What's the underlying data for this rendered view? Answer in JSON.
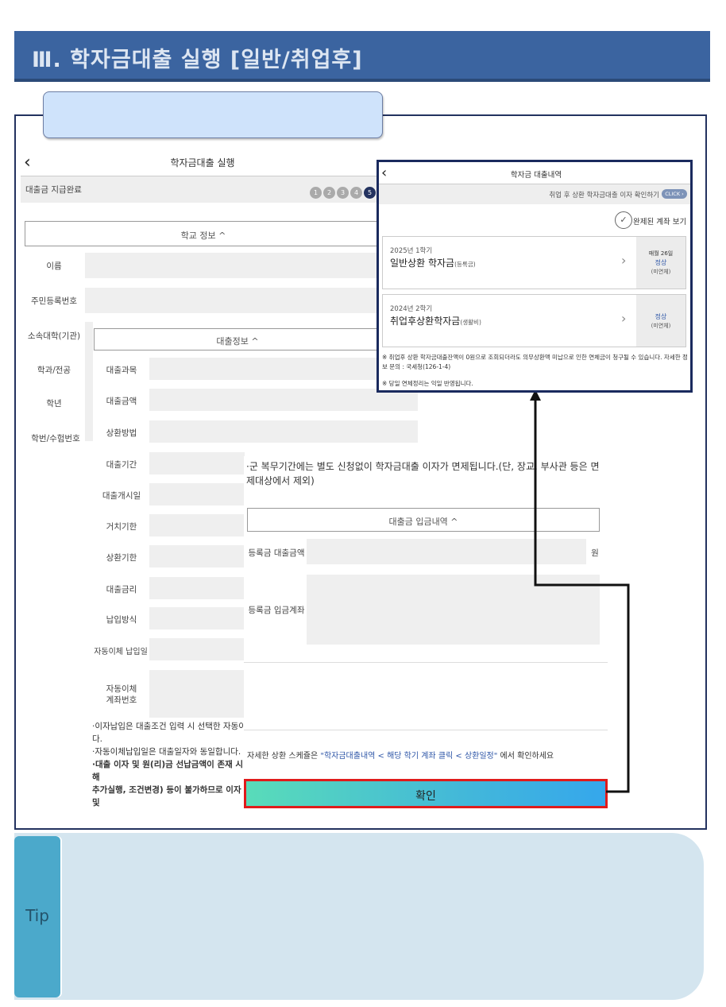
{
  "header": {
    "title": "Ⅲ. 학자금대출 실행 [일반/취업후]"
  },
  "app": {
    "title": "학자금대출 실행",
    "status": "대출금 지급완료",
    "steps": [
      "1",
      "2",
      "3",
      "4",
      "5"
    ],
    "school_section": "학교 정보 ^",
    "school_fields": [
      "이름",
      "주민등록번호",
      "소속대학(기관)",
      "학과/전공",
      "학년",
      "학번/수험번호"
    ],
    "loan_section": "대출정보 ^",
    "loan_fields": [
      "대출과목",
      "대출금액",
      "상환방법",
      "대출기간",
      "대출개시일",
      "거치기한",
      "상환기한",
      "대출금리",
      "납입방식",
      "자동이체 납입일"
    ],
    "auto_account_label": "자동이체\n계좌번호",
    "notes": {
      "line1": "·이자납입은 대출조건 입력 시 선택한 자동이",
      "line2": "다.",
      "line3": "·자동이체납입일은 대출일자와 동일합니다.",
      "line4": "·대출 이자 및 원(리)금 선납금액이 존재 시 해",
      "line5": "추가실행, 조건변경) 등이 불가하므로 이자 및"
    }
  },
  "overlay": {
    "military_note": "·군 복무기간에는 별도 신청없이 학자금대출 이자가 면제됩니다.(단, 장교, 부사관 등은 면제대상에서 제외)",
    "deposit_section": "대출금 입금내역 ^",
    "tuition_amount_label": "등록금 대출금액",
    "currency_unit": "원",
    "tuition_account_label": "등록금 입금계좌",
    "schedule_note_prefix": "자세한 상환 스케쥴은 ",
    "schedule_note_path": "\"학자금대출내역 < 해당 학기 계좌 클릭 < 상환일정\"",
    "schedule_note_suffix": " 에서 확인하세요",
    "confirm": "확인"
  },
  "popup": {
    "title": "학자금 대출내역",
    "interest_check": "취업 후 상환 학자금대출 이자 확인하기",
    "click_badge": "CLICK",
    "completed_accounts": "완제된 계좌 보기",
    "loans": [
      {
        "term": "2025년 1학기",
        "name": "일반상환 학자금",
        "sub": "(등록금)",
        "due": "매월 26일",
        "status": "정상",
        "overdue": "(미연체)"
      },
      {
        "term": "2024년 2학기",
        "name": "취업후상환학자금",
        "sub": "(생활비)",
        "due": "",
        "status": "정상",
        "overdue": "(미연체)"
      }
    ],
    "notice1": "※ 취업후 상환 학자금대출잔액이 0원으로 조회되더라도 의무상환액 미납으로 인한 연체금이 청구될 수 있습니다. 자세한 정보 문의 : 국세청(126-1-4)",
    "notice2": "※ 당일 연체정리는 익일 반영됩니다."
  },
  "tip": {
    "label": "Tip"
  },
  "colors": {
    "title_bar": "#3b64a0",
    "frame": "#23325f",
    "highlight": "#e01b1b",
    "tip_tab": "#4ba9cb"
  }
}
